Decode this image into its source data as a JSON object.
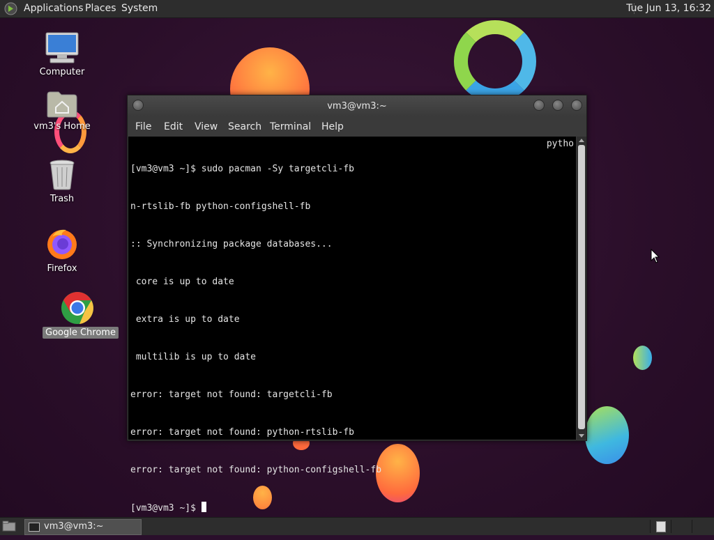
{
  "top_panel": {
    "menus": [
      "Applications",
      "Places",
      "System"
    ],
    "clock": "Tue Jun 13, 16:32"
  },
  "desktop_icons": [
    {
      "label": "Computer",
      "icon": "computer-icon"
    },
    {
      "label": "vm3's Home",
      "icon": "home-folder-icon"
    },
    {
      "label": "Trash",
      "icon": "trash-icon"
    },
    {
      "label": "Firefox",
      "icon": "firefox-icon"
    },
    {
      "label": "Google Chrome",
      "icon": "chrome-icon",
      "selected": true
    }
  ],
  "terminal": {
    "title": "vm3@vm3:~",
    "menus": [
      "File",
      "Edit",
      "View",
      "Search",
      "Terminal",
      "Help"
    ],
    "lines": [
      "[vm3@vm3 ~]$ sudo pacman -Sy targetcli-fb",
      "n-rtslib-fb python-configshell-fb",
      ":: Synchronizing package databases...",
      " core is up to date",
      " extra is up to date",
      " multilib is up to date",
      "error: target not found: targetcli-fb",
      "error: target not found: python-rtslib-fb",
      "error: target not found: python-configshell-fb"
    ],
    "wrapped_tail": "pytho",
    "prompt": "[vm3@vm3 ~]$ "
  },
  "bottom_panel": {
    "task_label": "vm3@vm3:~"
  },
  "colors": {
    "panel": "#2d2d2d",
    "terminal_bg": "#000000",
    "desktop_bg": "#2a0f2b"
  }
}
